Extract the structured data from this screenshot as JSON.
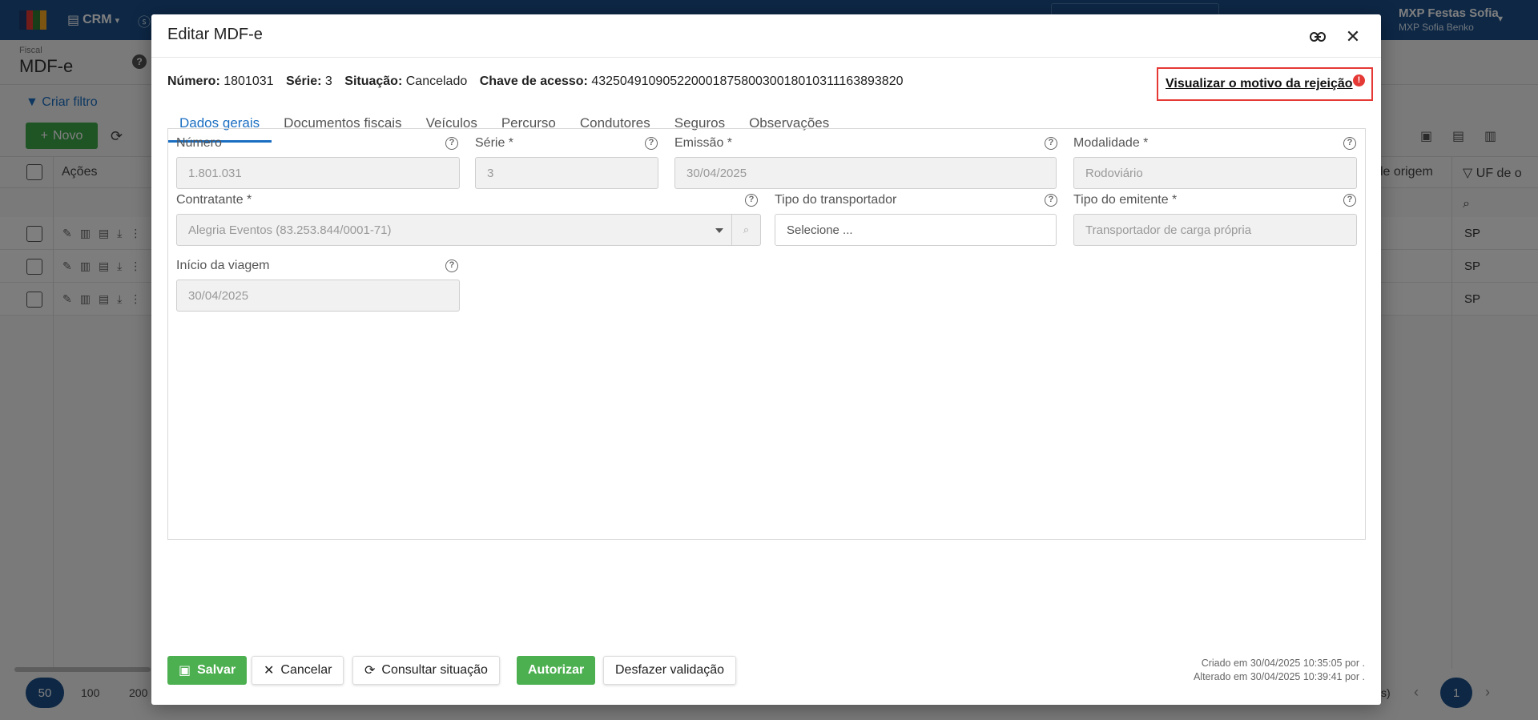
{
  "app": {
    "module": "CRM",
    "user_name": "MXP Festas Sofia",
    "user_sub": "MXP Sofia Benko",
    "breadcrumb": "Fiscal",
    "page_title": "MDF-e",
    "filter_label": "Criar filtro",
    "new_label": "Novo",
    "col_actions": "Ações",
    "col_origin": "le origem",
    "col_uf": "UF de o",
    "rows": [
      "SP",
      "SP",
      "SP"
    ],
    "pager": {
      "sizes": [
        "50",
        "100",
        "200"
      ],
      "active_size": "50",
      "current_page": "1",
      "count_suffix": "s)"
    }
  },
  "modal": {
    "title": "Editar MDF-e",
    "info": {
      "numero_label": "Número:",
      "numero_value": "1801031",
      "serie_label": "Série:",
      "serie_value": "3",
      "situacao_label": "Situação:",
      "situacao_value": "Cancelado",
      "chave_label": "Chave de acesso:",
      "chave_value": "43250491090522000187580030018010311163893820"
    },
    "reject_link": "Visualizar o motivo da rejeição",
    "reject_badge": "!",
    "tabs": [
      "Dados gerais",
      "Documentos fiscais",
      "Veículos",
      "Percurso",
      "Condutores",
      "Seguros",
      "Observações"
    ],
    "active_tab": "Dados gerais",
    "fields": {
      "numero": {
        "label": "Número",
        "value": "1.801.031"
      },
      "serie": {
        "label": "Série *",
        "value": "3"
      },
      "emissao": {
        "label": "Emissão *",
        "value": "30/04/2025"
      },
      "modalidade": {
        "label": "Modalidade *",
        "value": "Rodoviário"
      },
      "contratante": {
        "label": "Contratante *",
        "value": "Alegria Eventos (83.253.844/0001-71)"
      },
      "tipo_transportador": {
        "label": "Tipo do transportador",
        "placeholder": "Selecione ..."
      },
      "tipo_emitente": {
        "label": "Tipo do emitente *",
        "value": "Transportador de carga própria"
      },
      "inicio_viagem": {
        "label": "Início da viagem",
        "value": "30/04/2025"
      }
    },
    "buttons": {
      "salvar": "Salvar",
      "cancelar": "Cancelar",
      "consultar": "Consultar situação",
      "autorizar": "Autorizar",
      "desfazer": "Desfazer validação"
    },
    "audit": {
      "created": "Criado em 30/04/2025 10:35:05 por .",
      "updated": "Alterado em 30/04/2025 10:39:41 por ."
    }
  },
  "colors": {
    "primary": "#1a4f8a",
    "accent": "#1a6ec2",
    "success": "#4caf50",
    "danger": "#e53935"
  }
}
